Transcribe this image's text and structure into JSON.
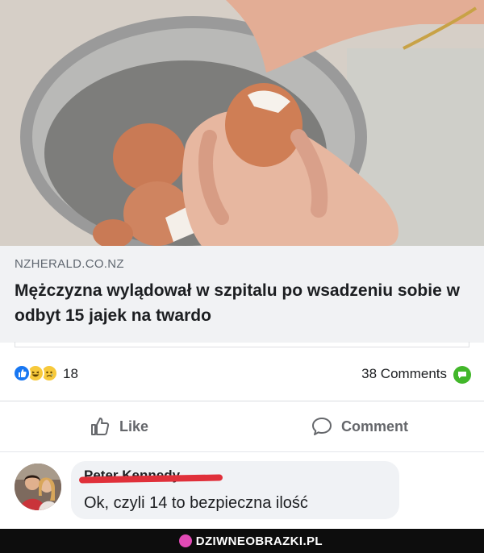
{
  "link_preview": {
    "domain": "NZHERALD.CO.NZ",
    "headline": "Mężczyzna wylądował w szpitalu po wsadzeniu sobie w odbyt 15 jajek na twardo"
  },
  "stats": {
    "reaction_count": "18",
    "comments_count": "38 Comments",
    "reactions": [
      "like-icon",
      "haha-icon",
      "sad-icon"
    ]
  },
  "actions": {
    "like_label": "Like",
    "comment_label": "Comment"
  },
  "comment": {
    "author": "Peter Kennedy",
    "text": "Ok, czyli 14 to bezpieczna ilość"
  },
  "footer": {
    "brand": "DZIWNEOBRAZKI.PL"
  },
  "colors": {
    "like_blue": "#1877f2",
    "comments_green": "#42b72a",
    "redaction_red": "#e0303a"
  }
}
